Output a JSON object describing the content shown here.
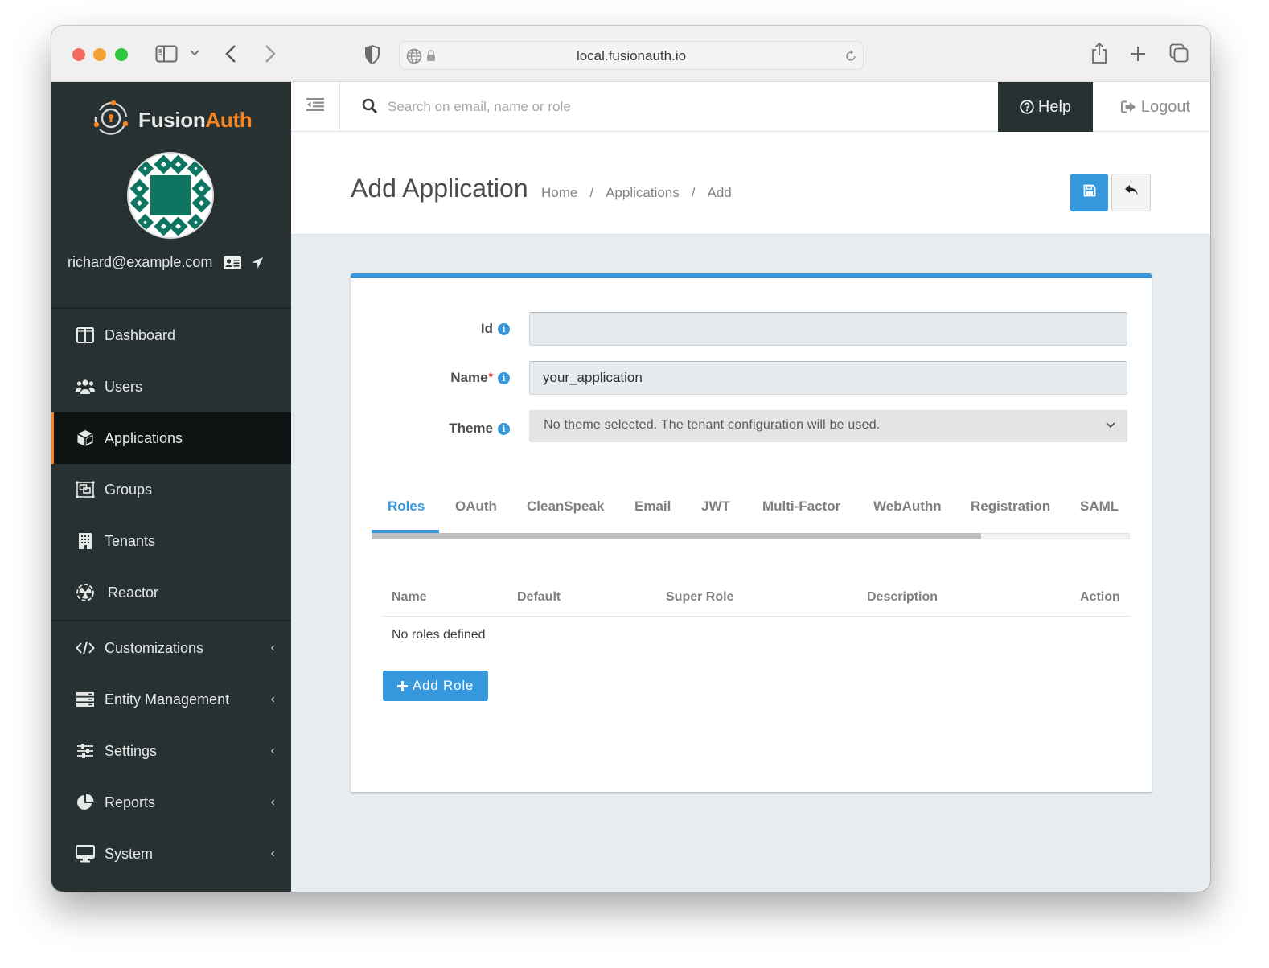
{
  "browser": {
    "url": "local.fusionauth.io",
    "icons": [
      "sidebar-toggle-icon",
      "chevron-down-icon",
      "back-arrow-icon",
      "forward-arrow-icon",
      "shield-icon",
      "globe-icon",
      "lock-icon",
      "reload-icon",
      "share-icon",
      "new-tab-icon",
      "tabs-overview-icon"
    ]
  },
  "brand": {
    "fusion": "Fusion",
    "auth": "Auth",
    "accent_color": "#f58320"
  },
  "user": {
    "email": "richard@example.com"
  },
  "sidebar": {
    "items": [
      {
        "label": "Dashboard",
        "icon": "dashboard-icon",
        "active": false,
        "expandable": false
      },
      {
        "label": "Users",
        "icon": "users-icon",
        "active": false,
        "expandable": false
      },
      {
        "label": "Applications",
        "icon": "cube-icon",
        "active": true,
        "expandable": false
      },
      {
        "label": "Groups",
        "icon": "groups-icon",
        "active": false,
        "expandable": false
      },
      {
        "label": "Tenants",
        "icon": "building-icon",
        "active": false,
        "expandable": false
      },
      {
        "label": "Reactor",
        "icon": "radiation-icon",
        "active": false,
        "expandable": false
      },
      {
        "label": "Customizations",
        "icon": "code-icon",
        "active": false,
        "expandable": true
      },
      {
        "label": "Entity Management",
        "icon": "server-icon",
        "active": false,
        "expandable": true
      },
      {
        "label": "Settings",
        "icon": "sliders-icon",
        "active": false,
        "expandable": true
      },
      {
        "label": "Reports",
        "icon": "pie-chart-icon",
        "active": false,
        "expandable": true
      },
      {
        "label": "System",
        "icon": "desktop-icon",
        "active": false,
        "expandable": true
      }
    ],
    "chevron": "‹"
  },
  "topbar": {
    "search_placeholder": "Search on email, name or role",
    "help_label": "Help",
    "logout_label": "Logout"
  },
  "page": {
    "title": "Add Application",
    "breadcrumb": [
      "Home",
      "Applications",
      "Add"
    ],
    "breadcrumb_separator": "/"
  },
  "form": {
    "id": {
      "label": "Id",
      "value": "",
      "required": false
    },
    "name": {
      "label": "Name",
      "value": "your_application",
      "required": true,
      "required_mark": "*"
    },
    "theme": {
      "label": "Theme",
      "selected": "No theme selected. The tenant configuration will be used.",
      "required": false
    }
  },
  "tabs": {
    "items": [
      "Roles",
      "OAuth",
      "CleanSpeak",
      "Email",
      "JWT",
      "Multi-Factor",
      "WebAuthn",
      "Registration",
      "SAML"
    ],
    "active": "Roles"
  },
  "roles": {
    "columns": [
      "Name",
      "Default",
      "Super Role",
      "Description",
      "Action"
    ],
    "empty_message": "No roles defined",
    "add_button": "Add Role"
  },
  "colors": {
    "primary": "#3597dc",
    "sidebar_bg": "#273132",
    "active_bg": "#0f1314",
    "required": "#e0383e"
  }
}
